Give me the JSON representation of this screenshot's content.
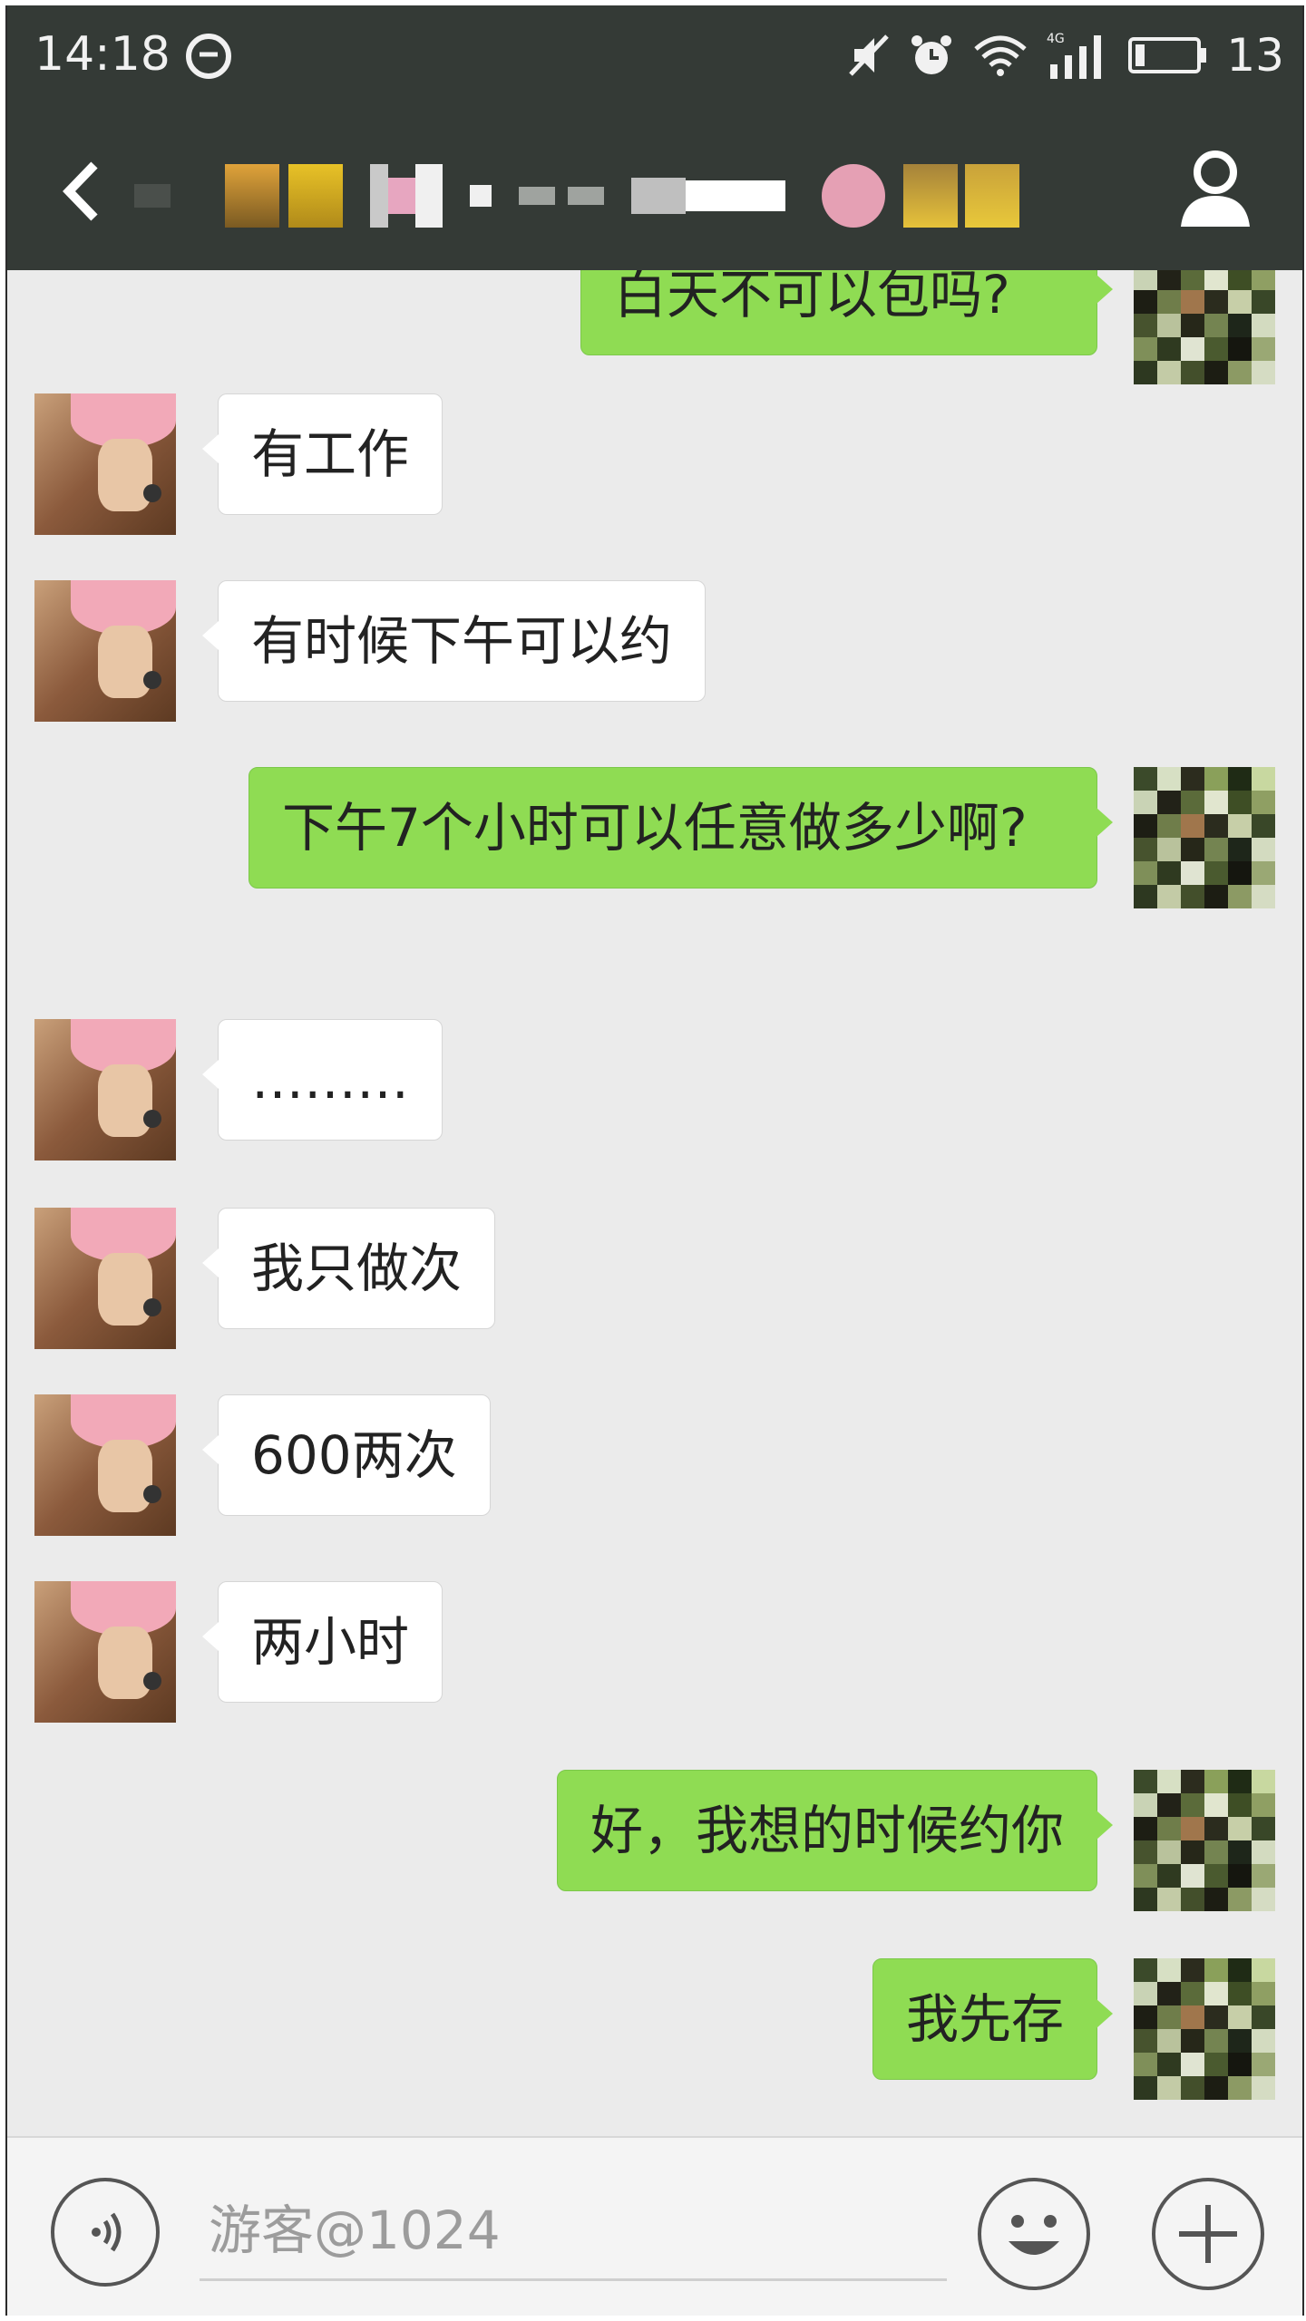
{
  "status_bar": {
    "time": "14:18",
    "battery": "13",
    "network_label": "4G"
  },
  "title_bar": {
    "back_icon": "chevron-left-icon",
    "title_note": "",
    "profile_icon": "person-icon"
  },
  "messages": [
    {
      "side": "right",
      "text": "白天不可以包吗?"
    },
    {
      "side": "left",
      "text": "有工作"
    },
    {
      "side": "left",
      "text": "有时候下午可以约"
    },
    {
      "side": "right",
      "text": "下午7个小时可以任意做多少啊?"
    },
    {
      "side": "left",
      "text": "………"
    },
    {
      "side": "left",
      "text": "我只做次"
    },
    {
      "side": "left",
      "text": "600两次"
    },
    {
      "side": "left",
      "text": "两小时"
    },
    {
      "side": "right",
      "text": "好，我想的时候约你"
    },
    {
      "side": "right",
      "text": "我先存"
    }
  ],
  "input_bar": {
    "placeholder": "游客@1024",
    "voice_icon": "voice-icon",
    "emoji_icon": "emoji-icon",
    "plus_icon": "plus-icon"
  },
  "colors": {
    "topbar": "#343a36",
    "chat_background": "#ebebeb",
    "outgoing_bubble": "#8fdc53",
    "incoming_bubble": "#ffffff"
  }
}
